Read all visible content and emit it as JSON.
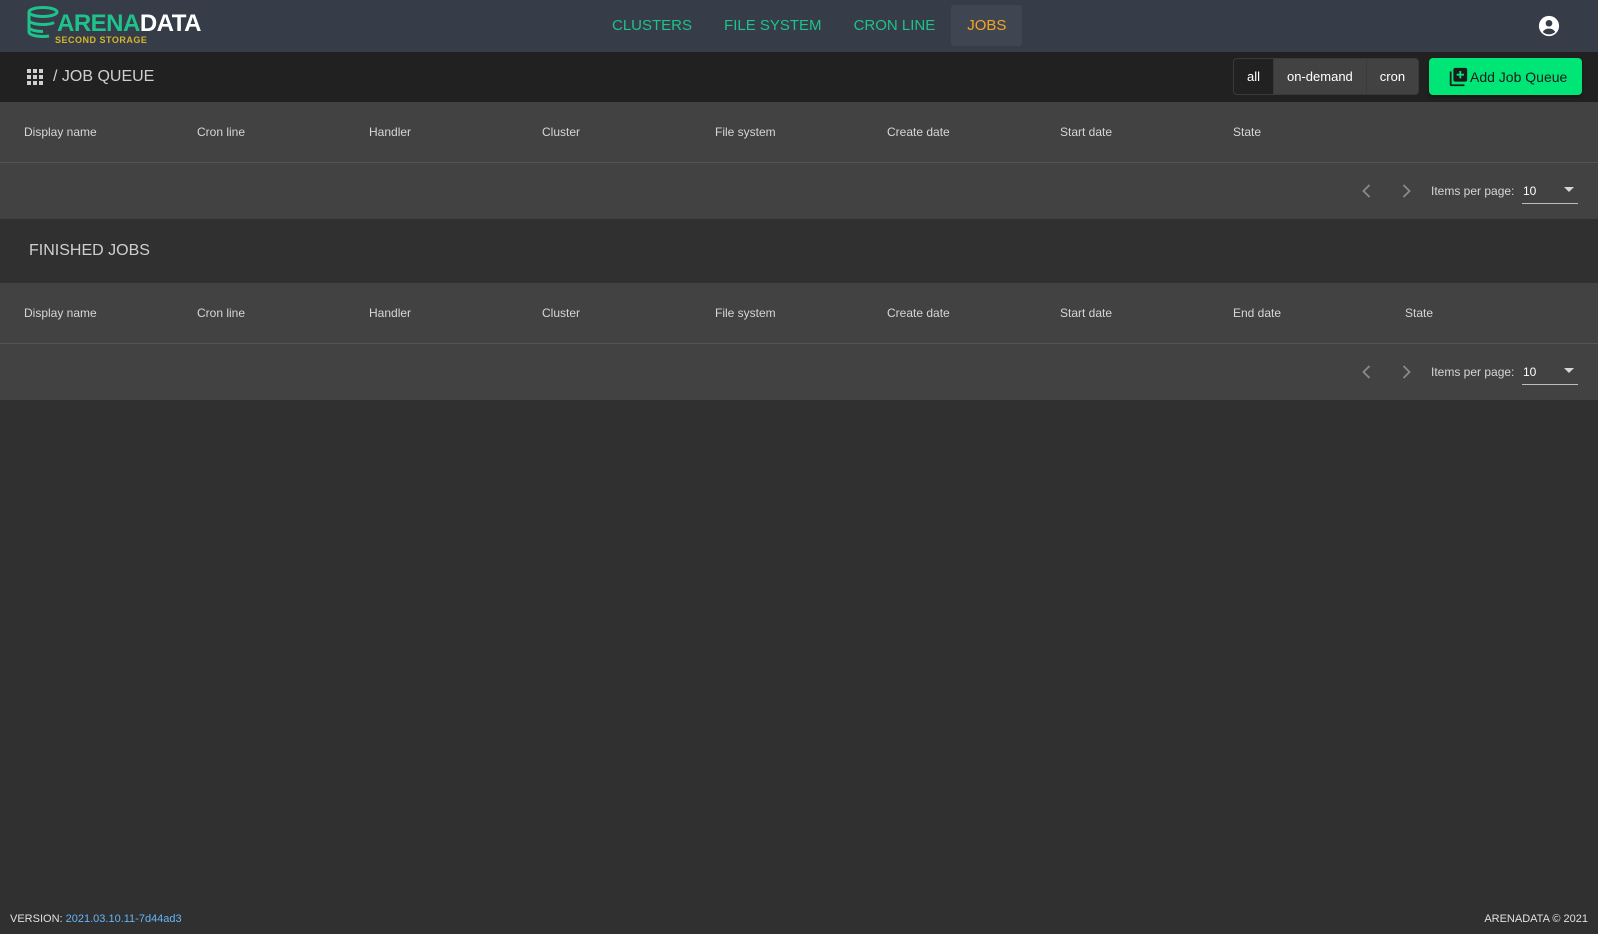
{
  "header": {
    "logo_main": "ARENA",
    "logo_accent": "DATA",
    "logo_sub": "SECOND STORAGE",
    "nav": [
      {
        "label": "CLUSTERS",
        "active": false
      },
      {
        "label": "FILE SYSTEM",
        "active": false
      },
      {
        "label": "CRON LINE",
        "active": false
      },
      {
        "label": "JOBS",
        "active": true
      }
    ],
    "account_icon": "account-circle-icon"
  },
  "toolbar": {
    "breadcrumb_icon": "apps-icon",
    "title": "/ JOB QUEUE",
    "filters": [
      {
        "label": "all",
        "selected": true
      },
      {
        "label": "on-demand",
        "selected": false
      },
      {
        "label": "cron",
        "selected": false
      }
    ],
    "add_button_label": "Add Job Queue",
    "add_button_icon": "library-add-icon"
  },
  "job_queue_table": {
    "columns": [
      "Display name",
      "Cron line",
      "Handler",
      "Cluster",
      "File system",
      "Create date",
      "Start date",
      "State"
    ],
    "rows": [],
    "paginator": {
      "items_per_page_label": "Items per page:",
      "items_per_page": "10"
    }
  },
  "finished_jobs": {
    "title": "FINISHED JOBS",
    "columns": [
      "Display name",
      "Cron line",
      "Handler",
      "Cluster",
      "File system",
      "Create date",
      "Start date",
      "End date",
      "State"
    ],
    "rows": [],
    "paginator": {
      "items_per_page_label": "Items per page:",
      "items_per_page": "10"
    }
  },
  "footer": {
    "version_label": "VERSION:",
    "version": "2021.03.10.11-7d44ad3",
    "copyright": "ARENADATA © 2021"
  },
  "colors": {
    "accent_green": "#1ec28b",
    "active_orange": "#f5a623",
    "button_green": "#00e676"
  }
}
